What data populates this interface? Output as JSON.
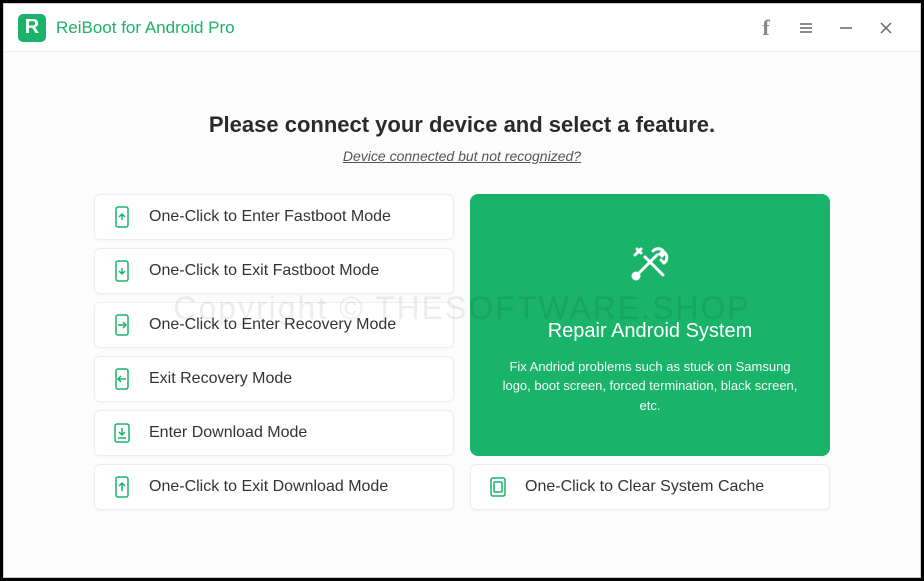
{
  "titlebar": {
    "app_name": "ReiBoot for Android Pro"
  },
  "main": {
    "heading": "Please connect your device and select a feature.",
    "sub_link": "Device connected but not recognized?"
  },
  "options": [
    {
      "icon": "phone-up",
      "label": "One-Click to Enter Fastboot Mode"
    },
    {
      "icon": "phone-down",
      "label": "One-Click to Exit Fastboot Mode"
    },
    {
      "icon": "phone-arrow-in",
      "label": "One-Click to Enter Recovery Mode"
    },
    {
      "icon": "phone-arrow-out",
      "label": "Exit Recovery Mode"
    },
    {
      "icon": "download",
      "label": "Enter Download Mode"
    },
    {
      "icon": "phone-up-alt",
      "label": "One-Click to Exit Download Mode"
    }
  ],
  "repair_card": {
    "title": "Repair Android System",
    "description": "Fix Andriod problems such as stuck on Samsung logo, boot screen, forced termination, black screen, etc."
  },
  "clear_cache": {
    "label": "One-Click to Clear System Cache"
  },
  "watermark": "Copyright © THESOFTWARE.SHOP",
  "colors": {
    "accent": "#19b36a"
  }
}
